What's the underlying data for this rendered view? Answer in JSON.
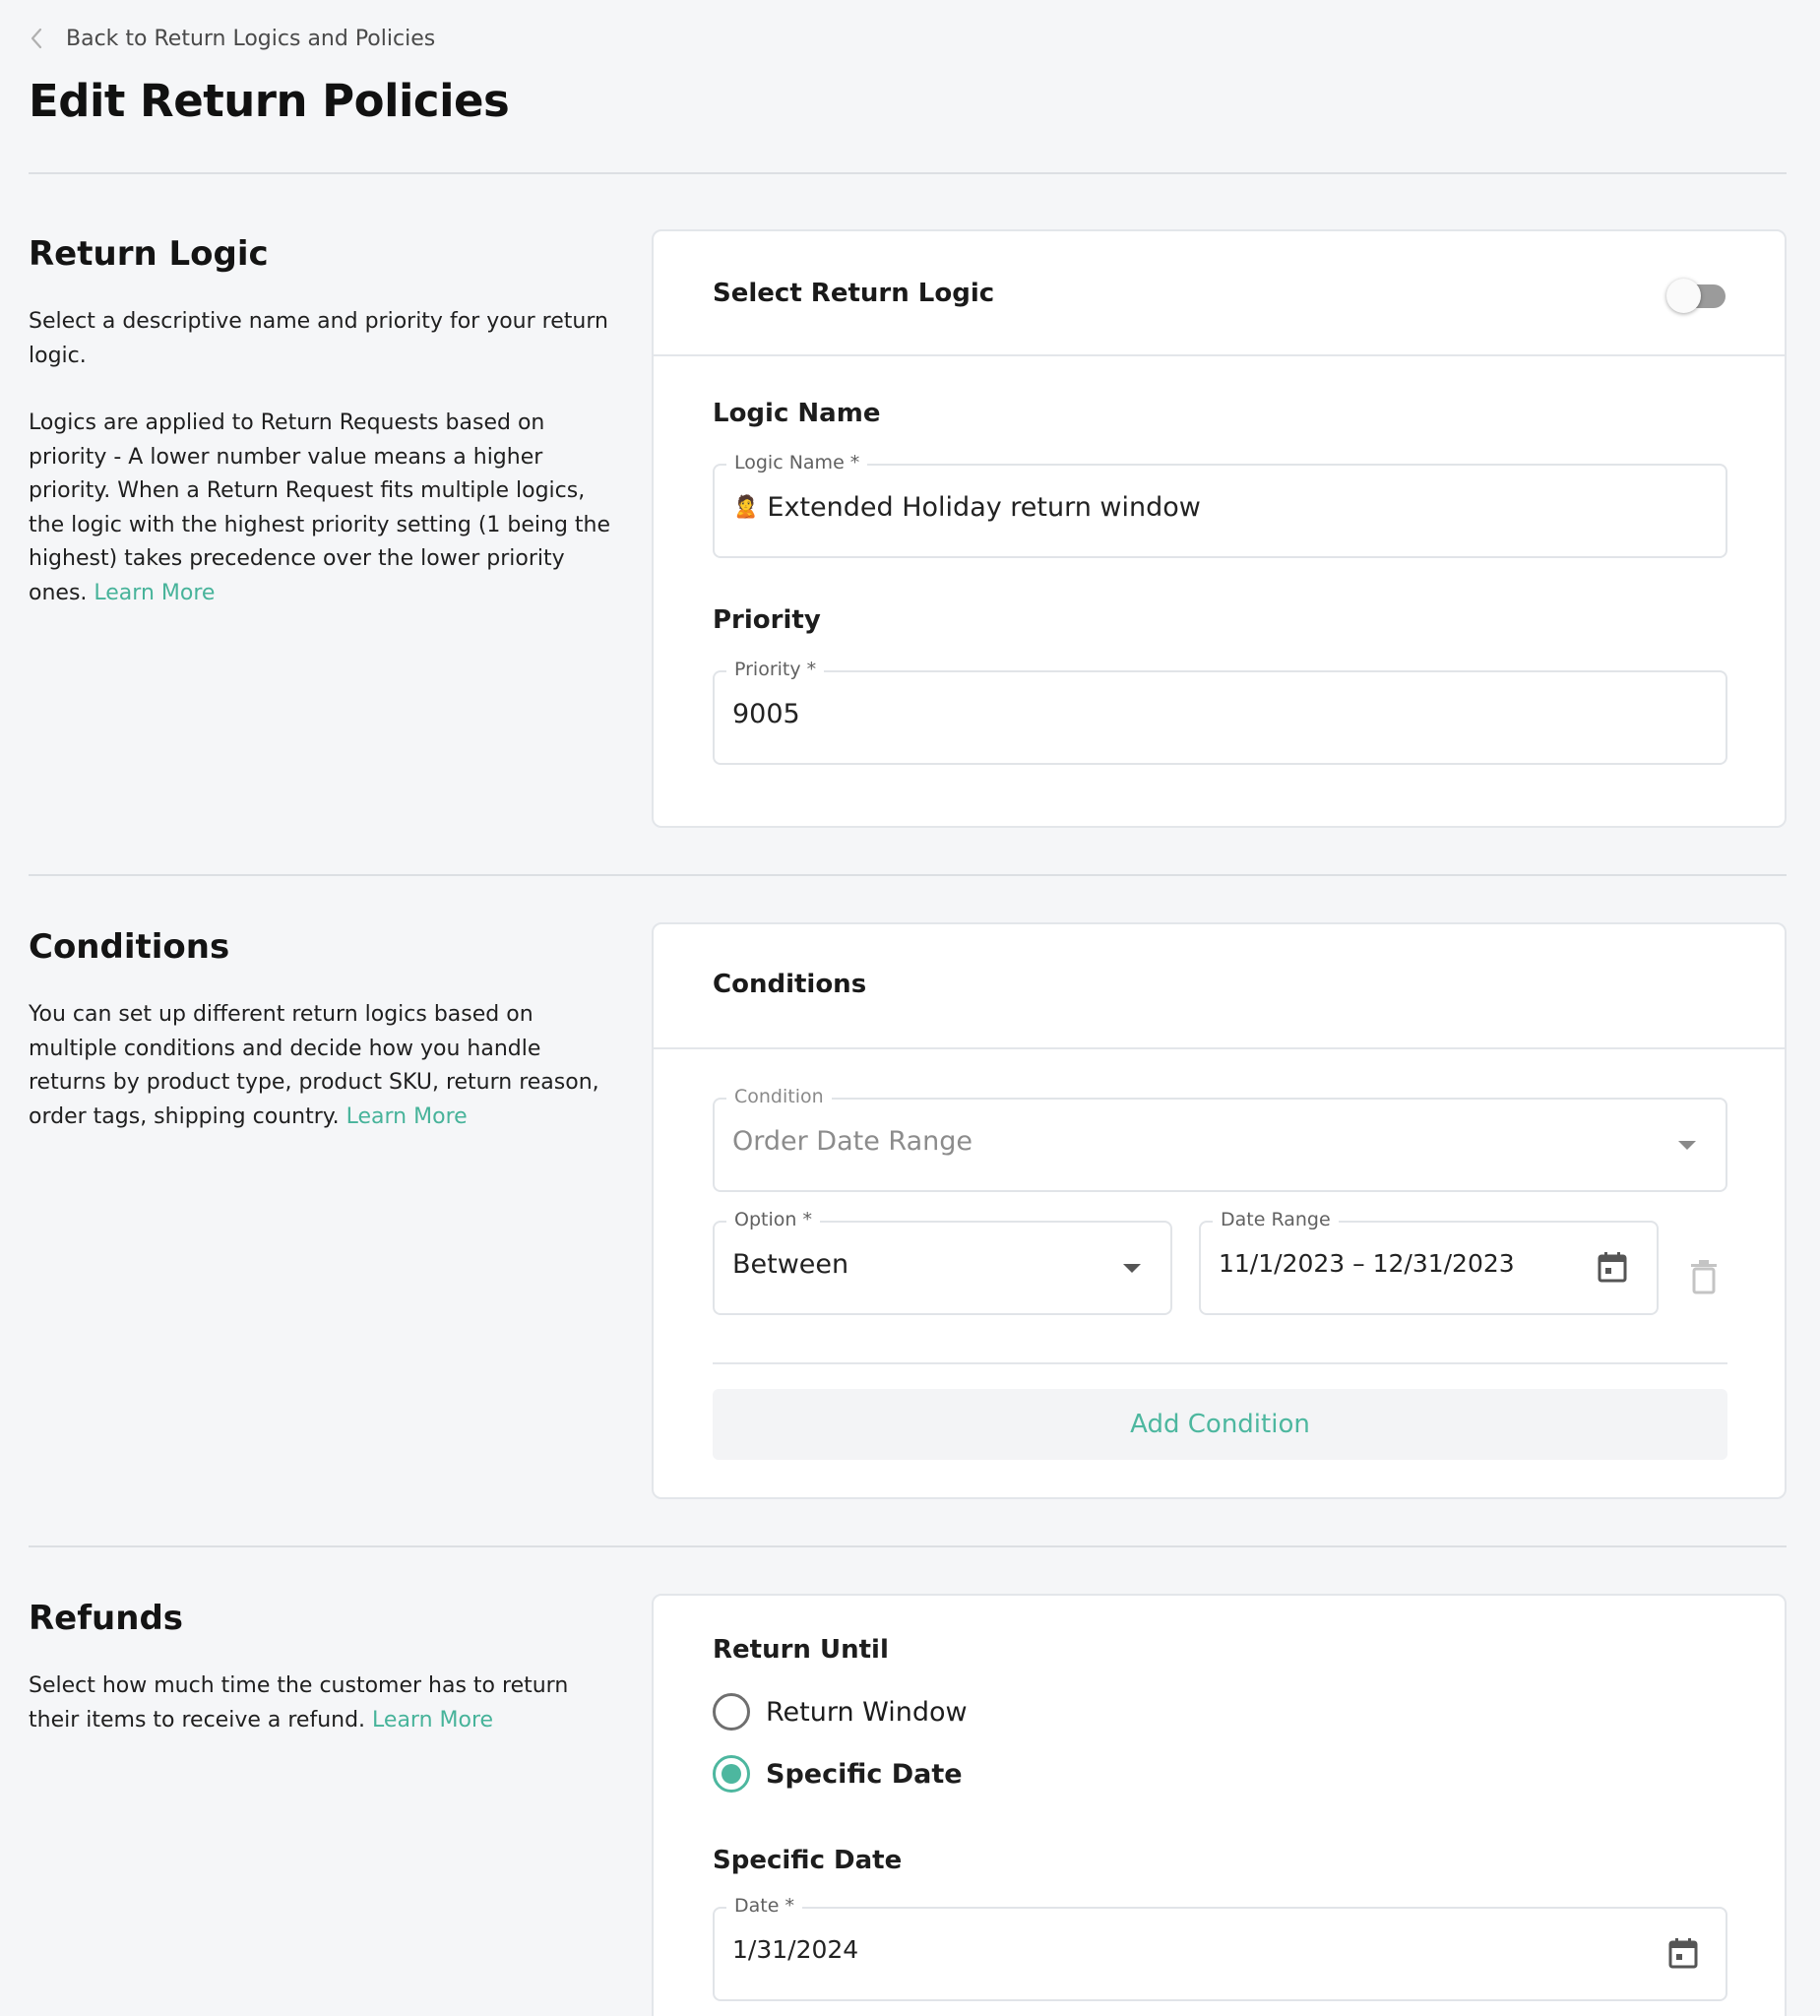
{
  "header": {
    "back_label": "Back to Return Logics and Policies",
    "title": "Edit Return Policies"
  },
  "return_logic_section": {
    "title": "Return Logic",
    "desc1": "Select a descriptive name and priority for your return logic.",
    "desc2": "Logics are applied to Return Requests based on priority - A lower number value means a higher priority. When a Return Request fits multiple logics, the logic with the highest priority setting (1 being the highest) takes precedence over the lower priority ones.",
    "learn_more": "Learn More",
    "card": {
      "header_title": "Select Return Logic",
      "toggle_on": false,
      "logic_name_label": "Logic Name",
      "logic_name_field_label": "Logic Name *",
      "logic_name_emoji": "🙎",
      "logic_name_value": "Extended Holiday return window",
      "priority_label": "Priority",
      "priority_field_label": "Priority *",
      "priority_value": "9005"
    }
  },
  "conditions_section": {
    "title": "Conditions",
    "desc": "You can set up different return logics based on multiple conditions and decide how you handle returns by product type, product SKU, return reason, order tags, shipping country.",
    "learn_more": "Learn More",
    "card": {
      "header_title": "Conditions",
      "condition_field_label": "Condition",
      "condition_value": "Order Date Range",
      "option_field_label": "Option *",
      "option_value": "Between",
      "date_range_field_label": "Date Range",
      "date_range_value": "11/1/2023 – 12/31/2023",
      "add_condition_label": "Add Condition"
    }
  },
  "refunds_section": {
    "title": "Refunds",
    "desc": "Select how much time the customer has to return their items to receive a refund.",
    "learn_more": "Learn More",
    "card": {
      "return_until_label": "Return Until",
      "radio_options": [
        {
          "label": "Return Window",
          "checked": false
        },
        {
          "label": "Specific Date",
          "checked": true
        }
      ],
      "specific_date_label": "Specific Date",
      "date_field_label": "Date *",
      "date_value": "1/31/2024"
    }
  },
  "colors": {
    "accent": "#4db79f",
    "link": "#47b39a",
    "background": "#f5f6f8"
  }
}
